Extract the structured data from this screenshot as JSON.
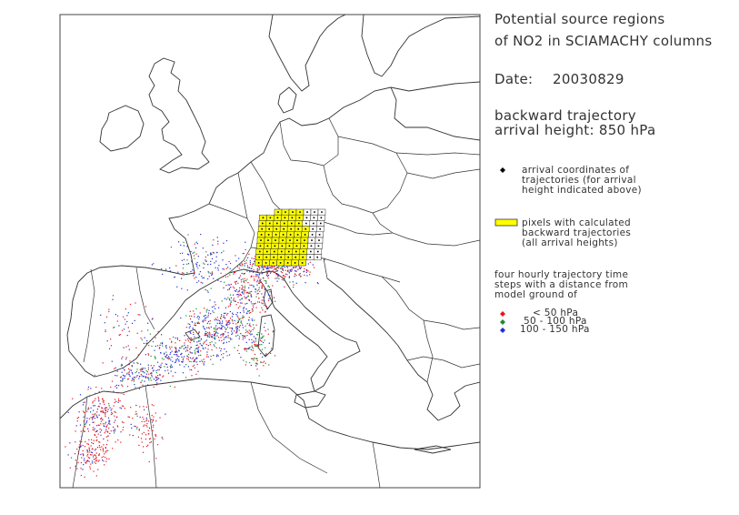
{
  "title_line1": "Potential source regions",
  "title_line2": "of NO2 in SCIAMACHY columns",
  "date_label": "Date:",
  "date_value": "20030829",
  "trajectory_line1": "backward trajectory",
  "trajectory_line2": "arrival height: 850 hPa",
  "legend": {
    "arrival": [
      "arrival coordinates of",
      "trajectories (for arrival",
      "height indicated above)"
    ],
    "pixels": [
      "pixels with calculated",
      "backward trajectories",
      "(all arrival heights)"
    ],
    "steps_intro": [
      "four hourly trajectory time",
      "steps with a distance from",
      "model ground of"
    ],
    "classes": [
      {
        "label": "< 50 hPa",
        "color": "#e8141c"
      },
      {
        "label": "50 - 100 hPa",
        "color": "#1f8a2e"
      },
      {
        "label": "100 - 150 hPa",
        "color": "#1e2fd6"
      }
    ],
    "arrival_color": "#000000",
    "pixel_color": "#ffff00"
  }
}
